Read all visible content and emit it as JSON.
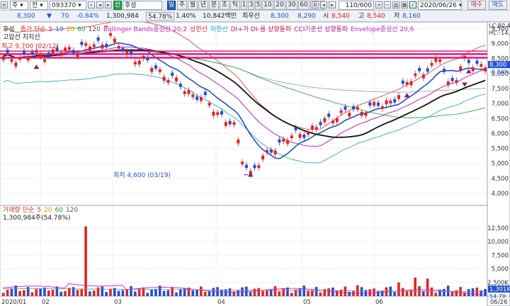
{
  "toolbar1": {
    "mode": "주",
    "mode2": "전",
    "code": "093370",
    "new_badge": "신",
    "name": "후성",
    "period_active": "일",
    "periods": [
      "주",
      "월",
      "년",
      "분",
      "초",
      "틱"
    ],
    "intervals": [
      "1",
      "3",
      "5",
      "10",
      "20",
      "30",
      "60",
      "120"
    ],
    "range": "110/600",
    "date": "2020/06/26",
    "buy_label": "매수",
    "sell_label": "매도"
  },
  "toolbar2": {
    "price": "8,300",
    "change": "70",
    "change_pct": "-0.84%",
    "volume": "1,300,984",
    "ratio": "54.78%",
    "turnover_pct": "1.40%",
    "amount": "10,842백만",
    "best_label": "최우선",
    "best_price": "8,300",
    "bid": "8,290",
    "open_label": "시",
    "open": "8,540",
    "high_label": "고",
    "high": "8,540",
    "low_label": "저",
    "low": "8,160"
  },
  "price_legend": {
    "name": "후성",
    "items": [
      {
        "text": "종가 단순",
        "color": "#c0392b"
      },
      {
        "text": "5",
        "color": "#d6306a"
      },
      {
        "text": "10",
        "color": "#1f4fd1"
      },
      {
        "text": "20",
        "color": "#d4a000"
      },
      {
        "text": "60",
        "color": "#1e9e3a"
      },
      {
        "text": "120",
        "color": "#555555"
      },
      {
        "text": "Bollinger Bands중심선 20,2",
        "color": "#c026c0"
      },
      {
        "text": "상한선",
        "color": "#e03030"
      },
      {
        "text": "하한선",
        "color": "#1aa0c8"
      },
      {
        "text": "DI+가 DI-를 상향돌파",
        "color": "#d0104a"
      },
      {
        "text": "CCI기준선 상향돌파",
        "color": "#b0108a"
      },
      {
        "text": "Envelope중심선 20,6",
        "color": "#c026c0"
      }
    ],
    "line2": "고압선  지지선"
  },
  "annotations": {
    "high": "최고 9,700 (02/12)",
    "low": "최저 4,600 (03/19)"
  },
  "right_price": {
    "lc": "LC:80,4",
    "hc": "HC:-14,",
    "current": "8,300",
    "pct": "-0.84%",
    "ticks": [
      "9,500",
      "9,000",
      "8,500",
      "8,000",
      "7,500",
      "7,000",
      "6,500",
      "6,000",
      "5,500",
      "5,000",
      "4,500",
      "4,000"
    ]
  },
  "volume_legend": {
    "items": [
      {
        "text": "거래량 단순",
        "color": "#c0392b"
      },
      {
        "text": "5",
        "color": "#d6306a"
      },
      {
        "text": "20",
        "color": "#d4a000"
      },
      {
        "text": "60",
        "color": "#1e9e3a"
      },
      {
        "text": "120",
        "color": "#555555"
      }
    ],
    "value": "1,300,984주(54.78%)"
  },
  "right_volume": {
    "ticks": [
      "12,500",
      "10,000",
      "7,500",
      "5,000",
      "2,500K"
    ],
    "current": "1,301K",
    "pct": "54.78"
  },
  "xaxis": {
    "labels": [
      "2020/01",
      "02",
      "03",
      "04",
      "05",
      "06",
      "06/26"
    ]
  },
  "colors": {
    "up": "#e02424",
    "down": "#1f4fd1",
    "hline": "#e8177a"
  }
}
